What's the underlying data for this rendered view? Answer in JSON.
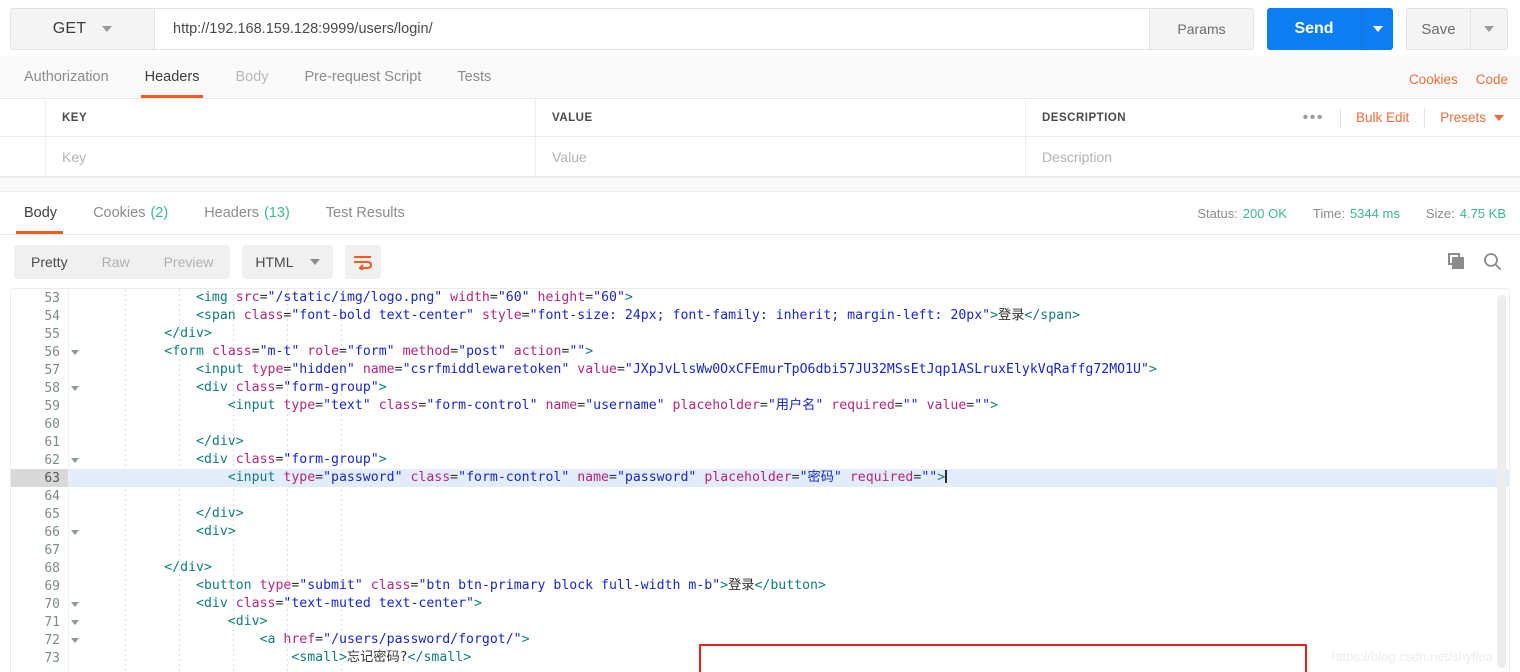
{
  "urlbar": {
    "method": "GET",
    "url": "http://192.168.159.128:9999/users/login/",
    "params_label": "Params",
    "send_label": "Send",
    "save_label": "Save"
  },
  "request_tabs": {
    "items": [
      {
        "label": "Authorization",
        "state": "normal"
      },
      {
        "label": "Headers",
        "state": "active"
      },
      {
        "label": "Body",
        "state": "muted"
      },
      {
        "label": "Pre-request Script",
        "state": "normal"
      },
      {
        "label": "Tests",
        "state": "normal"
      }
    ],
    "links": [
      {
        "label": "Cookies"
      },
      {
        "label": "Code"
      }
    ]
  },
  "headers_table": {
    "columns": [
      "KEY",
      "VALUE",
      "DESCRIPTION"
    ],
    "placeholders": [
      "Key",
      "Value",
      "Description"
    ],
    "actions": {
      "dots": "•••",
      "bulk_edit": "Bulk Edit",
      "presets": "Presets"
    }
  },
  "response_tabs": {
    "items": [
      {
        "label": "Body",
        "count": "",
        "state": "active"
      },
      {
        "label": "Cookies",
        "count": "(2)",
        "state": "normal"
      },
      {
        "label": "Headers",
        "count": "(13)",
        "state": "normal"
      },
      {
        "label": "Test Results",
        "count": "",
        "state": "normal"
      }
    ],
    "meta": [
      {
        "label": "Status:",
        "value": "200 OK"
      },
      {
        "label": "Time:",
        "value": "5344 ms"
      },
      {
        "label": "Size:",
        "value": "4.75 KB"
      }
    ]
  },
  "viewbar": {
    "modes": [
      {
        "label": "Pretty",
        "state": "active"
      },
      {
        "label": "Raw",
        "state": "normal"
      },
      {
        "label": "Preview",
        "state": "normal"
      }
    ],
    "language": "HTML"
  },
  "colors": {
    "accent_orange": "#ef5b25",
    "send_blue": "#0d7ef2",
    "status_green": "#3fb98c",
    "highlight_red": "#ee1c1c",
    "tag": "#117d7d",
    "attr": "#b6267f",
    "string": "#1a26cf"
  },
  "watermark": "https://blog.csdn.net/shyflea",
  "code": {
    "csrf_token": "JXpJvLlsWw0OxCFEmurTpO6dbi57JU32MSsEtJqp1ASLruxElykVqRaffg72MO1U",
    "active_line": 63,
    "lines": [
      {
        "n": 53,
        "fold": false,
        "text": "                <img src=\"/static/img/logo.png\" width=\"60\" height=\"60\">"
      },
      {
        "n": 54,
        "fold": false,
        "text": "                <span class=\"font-bold text-center\" style=\"font-size: 24px; font-family: inherit; margin-left: 20px\">登录</span>"
      },
      {
        "n": 55,
        "fold": false,
        "text": "            </div>"
      },
      {
        "n": 56,
        "fold": true,
        "text": "            <form class=\"m-t\" role=\"form\" method=\"post\" action=\"\">"
      },
      {
        "n": 57,
        "fold": false,
        "text": "                <input type=\"hidden\" name=\"csrfmiddlewaretoken\" value=\"JXpJvLlsWw0OxCFEmurTpO6dbi57JU32MSsEtJqp1ASLruxElykVqRaffg72MO1U\">"
      },
      {
        "n": 58,
        "fold": true,
        "text": "                <div class=\"form-group\">"
      },
      {
        "n": 59,
        "fold": false,
        "text": "                    <input type=\"text\" class=\"form-control\" name=\"username\" placeholder=\"用户名\" required=\"\" value=\"\">"
      },
      {
        "n": 60,
        "fold": false,
        "text": ""
      },
      {
        "n": 61,
        "fold": false,
        "text": "                </div>"
      },
      {
        "n": 62,
        "fold": true,
        "text": "                <div class=\"form-group\">"
      },
      {
        "n": 63,
        "fold": false,
        "text": "                    <input type=\"password\" class=\"form-control\" name=\"password\" placeholder=\"密码\" required=\"\">"
      },
      {
        "n": 64,
        "fold": false,
        "text": ""
      },
      {
        "n": 65,
        "fold": false,
        "text": "                </div>"
      },
      {
        "n": 66,
        "fold": true,
        "text": "                <div>"
      },
      {
        "n": 67,
        "fold": false,
        "text": ""
      },
      {
        "n": 68,
        "fold": false,
        "text": "            </div>"
      },
      {
        "n": 69,
        "fold": false,
        "text": "                <button type=\"submit\" class=\"btn btn-primary block full-width m-b\">登录</button>"
      },
      {
        "n": 70,
        "fold": true,
        "text": "                <div class=\"text-muted text-center\">"
      },
      {
        "n": 71,
        "fold": true,
        "text": "                    <div>"
      },
      {
        "n": 72,
        "fold": true,
        "text": "                        <a href=\"/users/password/forgot/\">"
      },
      {
        "n": 73,
        "fold": false,
        "text": "                            <small>忘记密码?</small>"
      }
    ]
  }
}
